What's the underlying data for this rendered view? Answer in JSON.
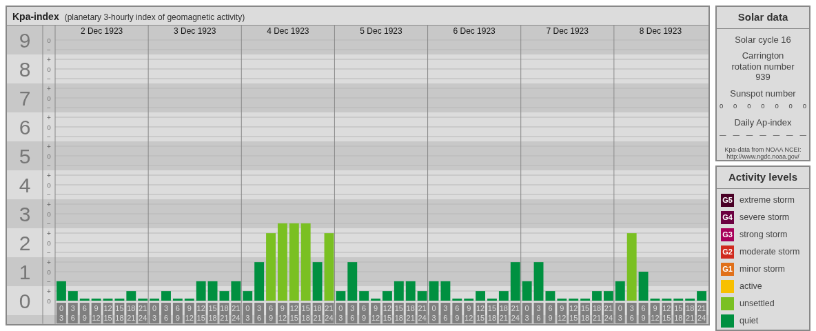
{
  "header": {
    "title": "Kpa-index",
    "subtitle": "(planetary 3-hourly index of geomagnetic activity)"
  },
  "chart": {
    "day_labels": [
      "2 Dec 1923",
      "3 Dec 1923",
      "4 Dec 1923",
      "5 Dec 1923",
      "6 Dec 1923",
      "7 Dec 1923",
      "8 Dec 1923"
    ],
    "y_minor_ticks": [
      "o",
      "−",
      "+",
      "o",
      "−",
      "+",
      "o",
      "−",
      "+",
      "o",
      "−",
      "+",
      "o",
      "−",
      "+",
      "o",
      "−",
      "+",
      "o",
      "−",
      "+",
      "o",
      "−",
      "+",
      "o",
      "−",
      "+",
      "o"
    ],
    "chart_data": {
      "type": "bar",
      "grid": true,
      "ylim": [
        -0.8,
        9.5
      ],
      "yticks": [
        {
          "value": 0,
          "label": "0"
        },
        {
          "value": 1,
          "label": "1"
        },
        {
          "value": 2,
          "label": "2"
        },
        {
          "value": 3,
          "label": "3"
        },
        {
          "value": 4,
          "label": "4"
        },
        {
          "value": 5,
          "label": "5"
        },
        {
          "value": 6,
          "label": "6"
        },
        {
          "value": 7,
          "label": "7"
        },
        {
          "value": 8,
          "label": "8"
        },
        {
          "value": 9,
          "label": "9"
        }
      ],
      "categories": [
        "0 3",
        "3 6",
        "6 9",
        "9 12",
        "12 15",
        "15 18",
        "18 21",
        "21 24",
        "0 3",
        "3 6",
        "6 9",
        "9 12",
        "12 15",
        "15 18",
        "18 21",
        "21 24",
        "0 3",
        "3 6",
        "6 9",
        "9 12",
        "12 15",
        "15 18",
        "18 21",
        "21 24",
        "0 3",
        "3 6",
        "6 9",
        "9 12",
        "12 15",
        "15 18",
        "18 21",
        "21 24",
        "0 3",
        "3 6",
        "6 9",
        "9 12",
        "12 15",
        "15 18",
        "18 21",
        "21 24",
        "0 3",
        "3 6",
        "6 9",
        "9 12",
        "12 15",
        "15 18",
        "18 21",
        "21 24",
        "0 3",
        "3 6",
        "6 9",
        "9 12",
        "12 15",
        "15 18",
        "18 21",
        "21 24"
      ],
      "series": [
        {
          "color": "#009040",
          "values": [
            0.67,
            0.33,
            0,
            0,
            0,
            0,
            0.33,
            0,
            0,
            0.33,
            0,
            0,
            0.67,
            0.67,
            0.33,
            0.67,
            0.33,
            1.33,
            null,
            null,
            null,
            null,
            1.33,
            null,
            0.33,
            1.33,
            0.33,
            0,
            0.33,
            0.67,
            0.67,
            0.33,
            0.67,
            0.67,
            0,
            0,
            0.33,
            0,
            0.33,
            1.33,
            0.67,
            1.33,
            0.33,
            0,
            0,
            0,
            0.33,
            0.33,
            0.67,
            null,
            1,
            0,
            0,
            0,
            0,
            0.33
          ]
        },
        {
          "color": "#7ac022",
          "values": [
            null,
            null,
            null,
            null,
            null,
            null,
            null,
            null,
            null,
            null,
            null,
            null,
            null,
            null,
            null,
            null,
            null,
            null,
            2.33,
            2.67,
            2.67,
            2.67,
            null,
            2.33,
            null,
            null,
            null,
            null,
            null,
            null,
            null,
            null,
            null,
            null,
            null,
            null,
            null,
            null,
            null,
            null,
            null,
            null,
            null,
            null,
            null,
            null,
            null,
            null,
            null,
            2.33,
            null,
            null,
            null,
            null,
            null,
            null
          ]
        }
      ]
    }
  },
  "solar_data": {
    "title": "Solar data",
    "solar_cycle": "Solar cycle 16",
    "carrington": "Carrington rotation number 939",
    "sunspot_heading": "Sunspot number",
    "sunspot_numbers": [
      "0",
      "0",
      "0",
      "0",
      "0",
      "0",
      "0"
    ],
    "ap_heading": "Daily Ap-index",
    "ap_values": [
      "—",
      "—",
      "—",
      "—",
      "—",
      "—",
      "—"
    ],
    "source": "Kpa-data from NOAA NCEI:",
    "source_url": "http://www.ngdc.noaa.gov/"
  },
  "activity_levels": {
    "title": "Activity levels",
    "items": [
      {
        "badge": "G5",
        "label": "extreme storm",
        "color": "#4a0026"
      },
      {
        "badge": "G4",
        "label": "severe storm",
        "color": "#6b0040"
      },
      {
        "badge": "G3",
        "label": "strong storm",
        "color": "#a8005a"
      },
      {
        "badge": "G2",
        "label": "moderate storm",
        "color": "#d02a1e"
      },
      {
        "badge": "G1",
        "label": "minor storm",
        "color": "#e0701a"
      },
      {
        "label": "active",
        "color": "#f8c000"
      },
      {
        "label": "unsettled",
        "color": "#7ac022"
      },
      {
        "label": "quiet",
        "color": "#009040"
      }
    ]
  }
}
